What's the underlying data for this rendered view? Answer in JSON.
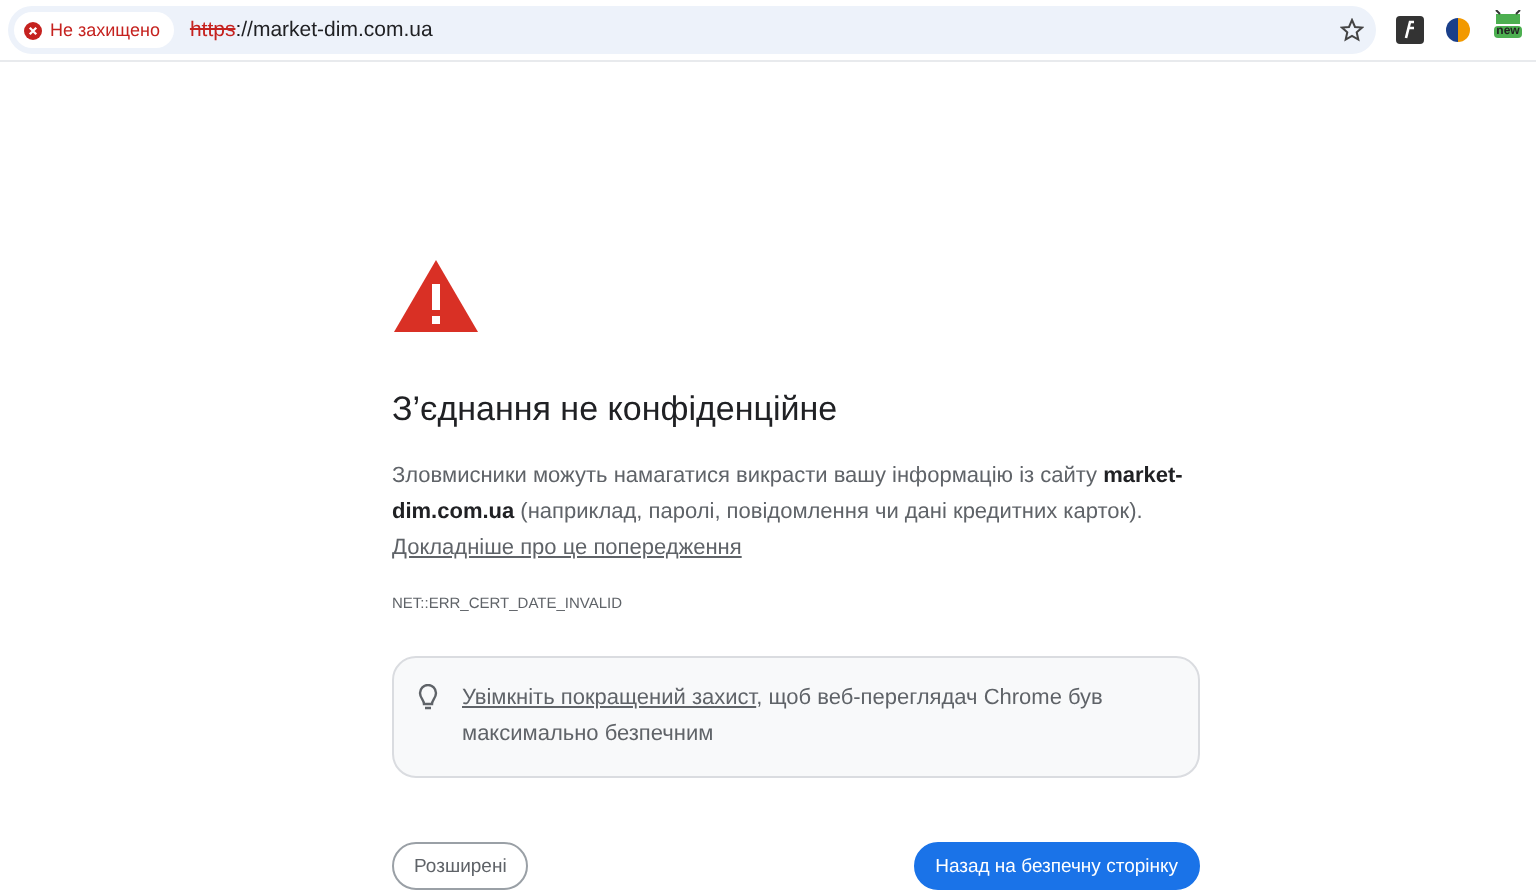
{
  "address_bar": {
    "security_chip": "Не захищено",
    "url_scheme": "https",
    "url_rest": "://market-dim.com.ua",
    "bookmarked": false
  },
  "extensions": [
    {
      "kind": "script"
    },
    {
      "kind": "half-circle"
    },
    {
      "kind": "badge",
      "badge": "new"
    }
  ],
  "interstitial": {
    "title": "З’єднання не конфіденційне",
    "message": "Зловмисники можуть намагатися викрасти вашу інформацію із сайту **market-dim.com.ua** (наприклад, паролі, повідомлення чи дані кредитних карток).",
    "message_link": "Докладніше про це попередження",
    "error_code": "NET::ERR_CERT_DATE_INVALID",
    "tip_link": "Увімкніть покращений захист",
    "tip_text": ", щоб веб-переглядач Chrome був максимально безпечним",
    "buttons": [
      {
        "label": "Розширені",
        "kind": "secondary"
      },
      {
        "label": "Назад на безпечну сторінку",
        "kind": "primary"
      }
    ]
  }
}
